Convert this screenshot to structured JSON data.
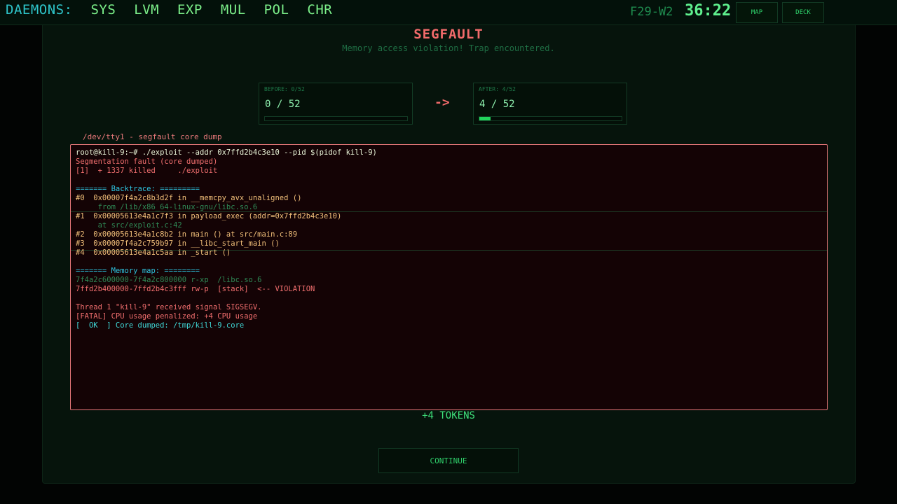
{
  "topbar": {
    "daemons_label": "DAEMONS:",
    "daemons": [
      "SYS",
      "LVM",
      "EXP",
      "MUL",
      "POL",
      "CHR"
    ],
    "week": "F29-W2",
    "clock": "36:22",
    "map_button": "MAP",
    "deck_button": "DECK"
  },
  "result": {
    "title": "SEGFAULT",
    "subtitle": "Memory access violation! Trap encountered.",
    "before_caption": "BEFORE: 0/52",
    "before_value": "0 / 52",
    "before_progress": 0,
    "arrow": "->",
    "after_caption": "AFTER: 4/52",
    "after_value": "4 / 52",
    "after_progress": 0.077
  },
  "terminal": {
    "label": "/dev/tty1 - segfault core dump",
    "lines": [
      "root@kill-9:~# ./exploit --addr 0x7ffd2b4c3e10 --pid $(pidof kill-9)",
      "Segmentation fault (core dumped)",
      "[1]  + 1337 killed     ./exploit",
      "======= Backtrace: =========",
      "#0  0x00007f4a2c8b3d2f in __memcpy_avx_unaligned ()",
      "     from /lib/x86_64-linux-gnu/libc.so.6",
      "#1  0x00005613e4a1c7f3 in payload_exec (addr=0x7ffd2b4c3e10)",
      "     at src/exploit.c:42",
      "#2  0x00005613e4a1c8b2 in main () at src/main.c:89",
      "#3  0x00007f4a2c759b97 in __libc_start_main ()",
      "#4  0x00005613e4a1c5aa in _start ()",
      "======= Memory map: ========",
      "7f4a2c600000-7f4a2c800000 r-xp  /libc.so.6",
      "7ffd2b400000-7ffd2b4c3fff rw-p  [stack]  <-- VIOLATION",
      "Thread 1 \"kill-9\" received signal SIGSEGV.",
      "[FATAL] CPU usage penalized: +4 CPU usage",
      "[  OK  ] Core dumped: /tmp/kill-9.core"
    ]
  },
  "reward": "+4 TOKENS",
  "continue_label": "CONTINUE"
}
